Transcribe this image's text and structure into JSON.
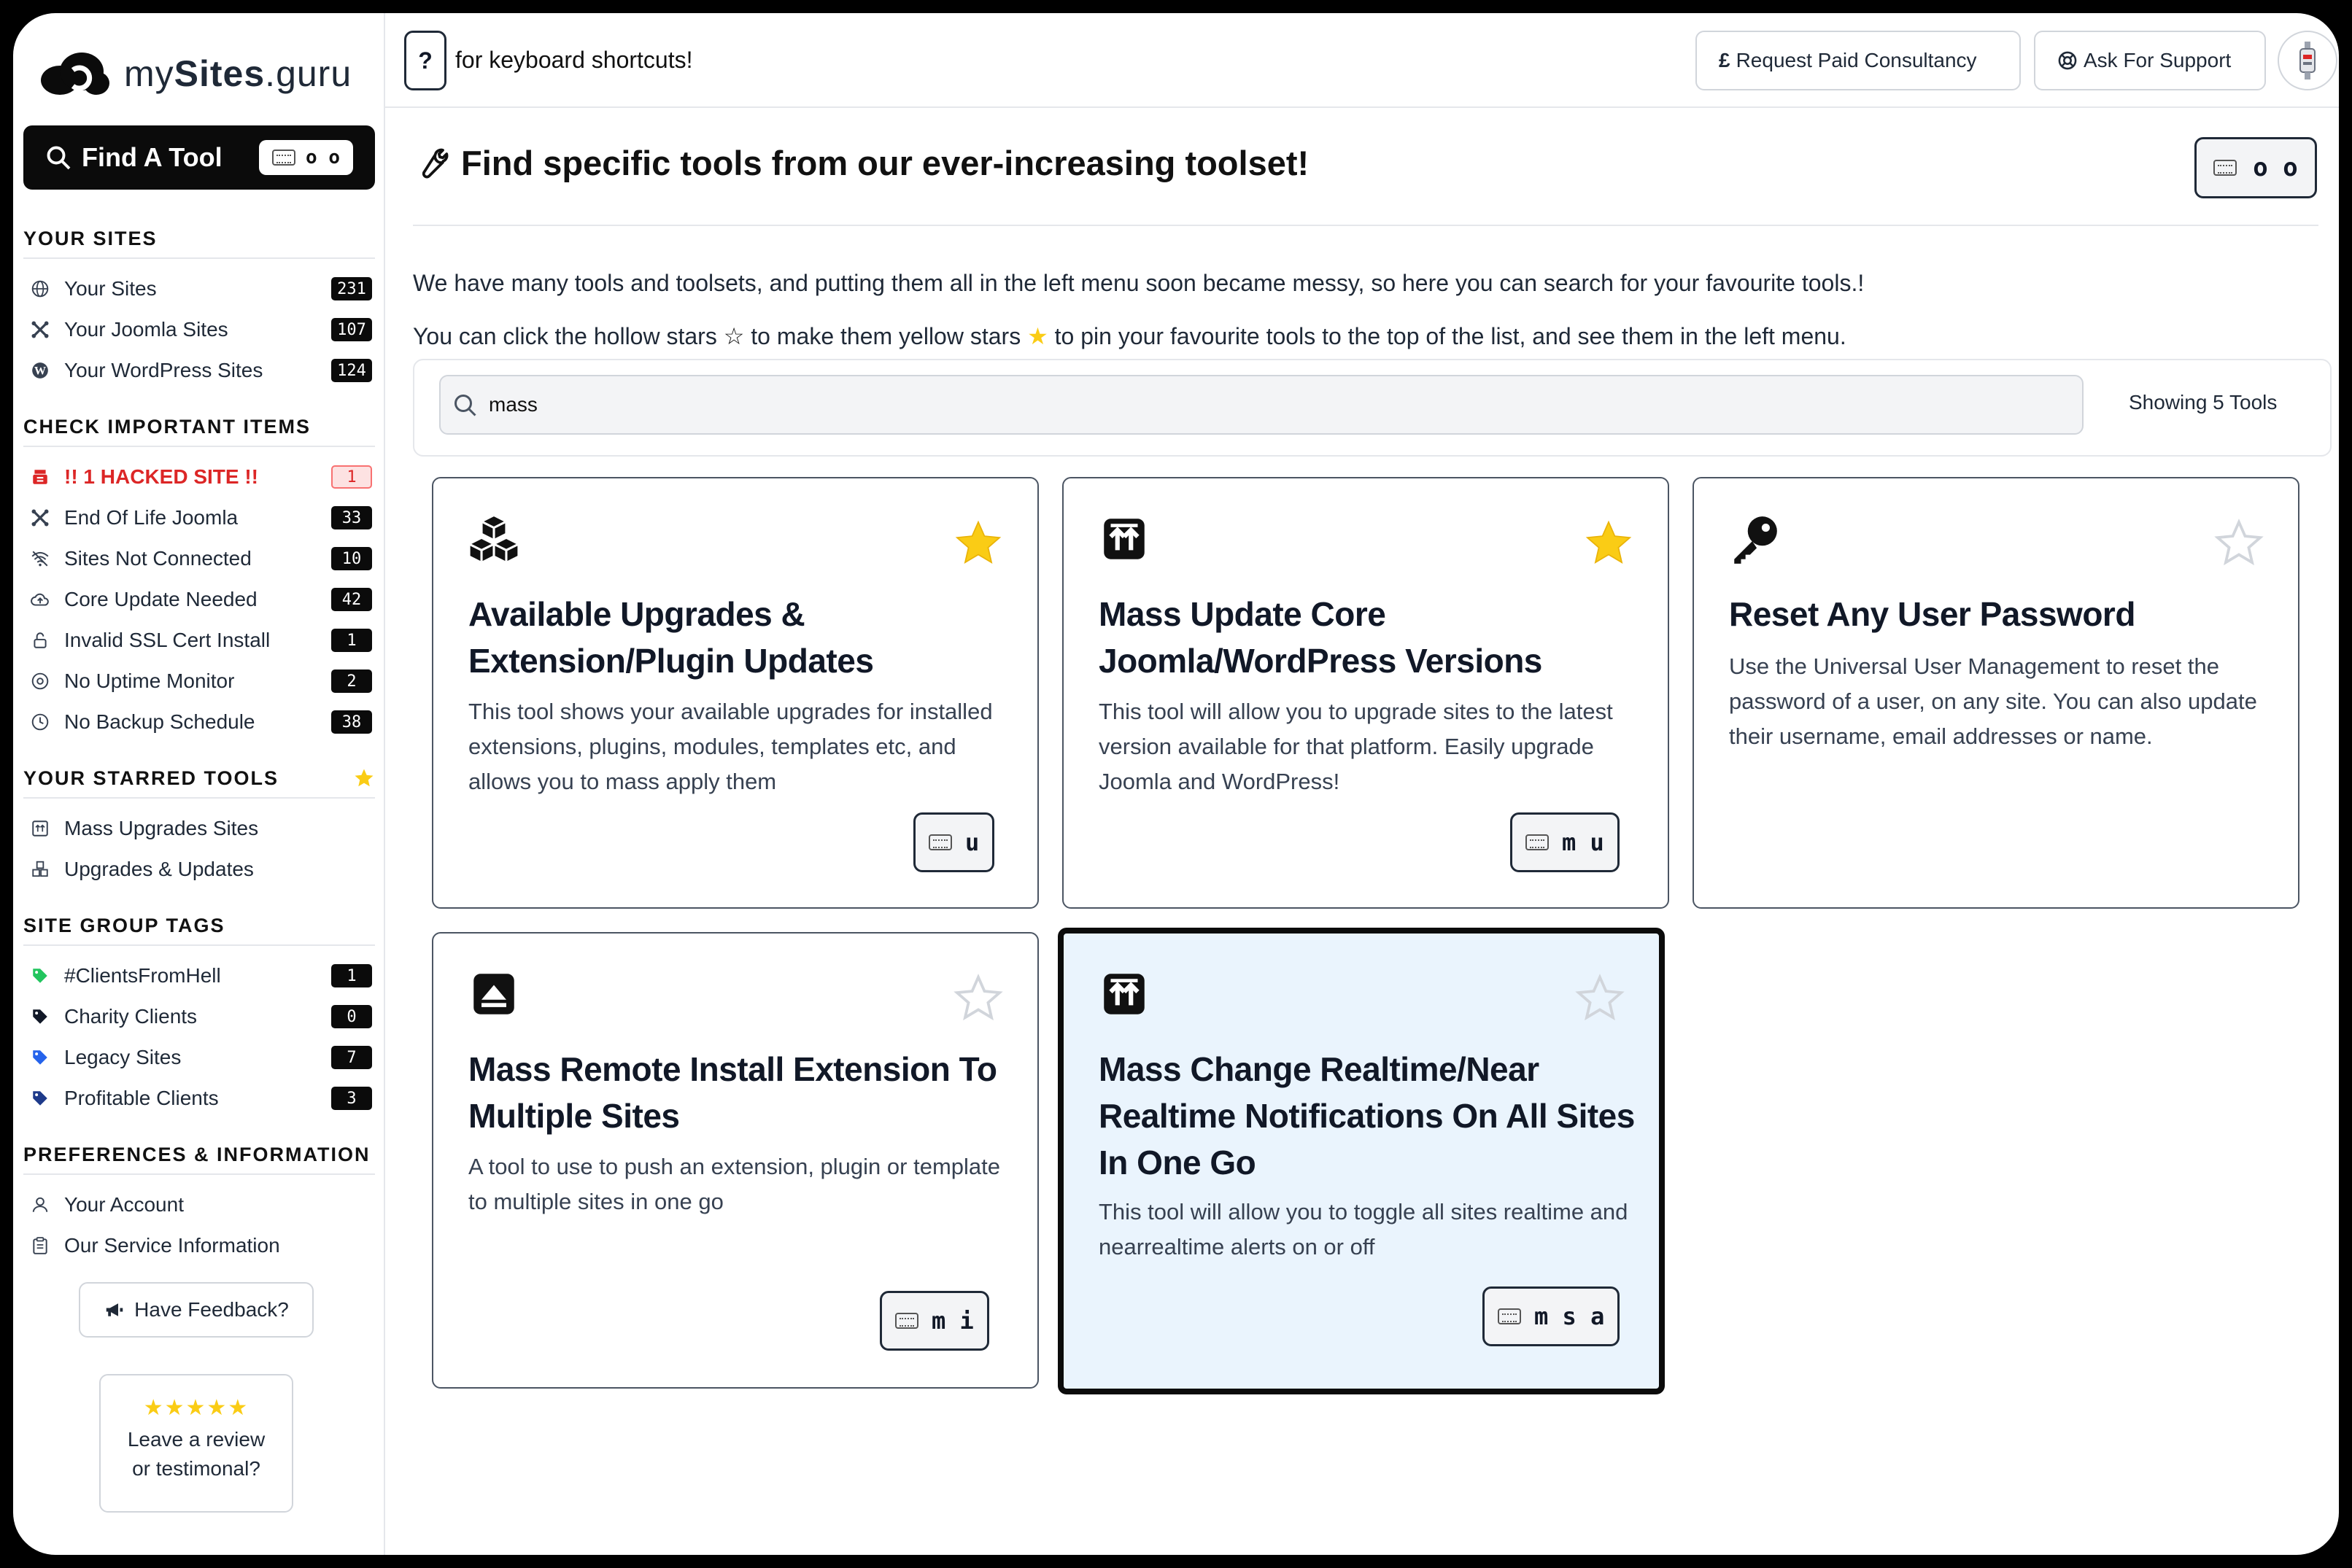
{
  "app": {
    "logo_pre": "my",
    "logo_bold": "Sites",
    "logo_post": ".guru"
  },
  "find_tool": {
    "label": "Find A Tool",
    "shortcut": "o o"
  },
  "sidebar": {
    "your_sites": {
      "title": "YOUR SITES",
      "items": [
        {
          "label": "Your Sites",
          "count": "231"
        },
        {
          "label": "Your Joomla Sites",
          "count": "107"
        },
        {
          "label": "Your WordPress Sites",
          "count": "124"
        }
      ]
    },
    "check_items": {
      "title": "CHECK IMPORTANT ITEMS",
      "items": [
        {
          "label": "!! 1 HACKED SITE !!",
          "count": "1"
        },
        {
          "label": "End Of Life Joomla",
          "count": "33"
        },
        {
          "label": "Sites Not Connected",
          "count": "10"
        },
        {
          "label": "Core Update Needed",
          "count": "42"
        },
        {
          "label": "Invalid SSL Cert Install",
          "count": "1"
        },
        {
          "label": "No Uptime Monitor",
          "count": "2"
        },
        {
          "label": "No Backup Schedule",
          "count": "38"
        }
      ]
    },
    "starred": {
      "title": "YOUR STARRED TOOLS",
      "items": [
        {
          "label": "Mass Upgrades Sites"
        },
        {
          "label": "Upgrades & Updates"
        }
      ]
    },
    "tags": {
      "title": "SITE GROUP TAGS",
      "items": [
        {
          "label": "#ClientsFromHell",
          "count": "1",
          "color": "#22c55e"
        },
        {
          "label": "Charity Clients",
          "count": "0",
          "color": "#111827"
        },
        {
          "label": "Legacy Sites",
          "count": "7",
          "color": "#2563eb"
        },
        {
          "label": "Profitable Clients",
          "count": "3",
          "color": "#1e3a8a"
        }
      ]
    },
    "prefs": {
      "title": "PREFERENCES & INFORMATION",
      "items": [
        {
          "label": "Your Account"
        },
        {
          "label": "Our Service Information"
        }
      ]
    },
    "feedback_label": "Have Feedback?",
    "review_line1": "Leave a review",
    "review_line2": "or testimonal?"
  },
  "header": {
    "shortcut_key": "?",
    "shortcut_text": "for keyboard shortcuts!",
    "consultancy": "Request Paid Consultancy",
    "support": "Ask For Support"
  },
  "main": {
    "title": "Find specific tools from our ever-increasing toolset!",
    "title_shortcut": "o o",
    "intro1": "We have many tools and toolsets, and putting them all in the left menu soon became messy, so here you can search for your favourite tools.!",
    "intro2_a": "You can click the hollow stars",
    "intro2_b": "to make them yellow stars",
    "intro2_c": "to pin your favourite tools to the top of the list, and see them in the left menu.",
    "search_value": "mass",
    "showing": "Showing 5 Tools",
    "cards": [
      {
        "title": "Available Upgrades & Extension/Plugin Updates",
        "desc": "This tool shows your available upgrades for installed extensions, plugins, modules, templates etc, and allows you to mass apply them",
        "shortcut": "u",
        "starred": true,
        "icon": "cubes-icon"
      },
      {
        "title": "Mass Update Core Joomla/WordPress Versions",
        "desc": "This tool will allow you to upgrade sites to the latest version available for that platform. Easily upgrade Joomla and WordPress!",
        "shortcut": "m u",
        "starred": true,
        "icon": "upload-arrows-icon"
      },
      {
        "title": "Reset Any User Password",
        "desc": "Use the Universal User Management to reset the password of a user, on any site. You can also update their username, email addresses or name.",
        "shortcut": "",
        "starred": false,
        "icon": "key-icon"
      },
      {
        "title": "Mass Remote Install Extension To Multiple Sites",
        "desc": "A tool to use to push an extension, plugin or template to multiple sites in one go",
        "shortcut": "m i",
        "starred": false,
        "icon": "eject-icon"
      },
      {
        "title": "Mass Change Realtime/Near Realtime Notifications On All Sites In One Go",
        "desc": "This tool will allow you to toggle all sites realtime and nearrealtime alerts on or off",
        "shortcut": "m s a",
        "starred": false,
        "icon": "upload-arrows-icon"
      }
    ]
  },
  "colors": {
    "accent": "#0b0b0b",
    "star": "#facc15",
    "active_card": "#eaf4fd",
    "danger": "#dc2626"
  }
}
